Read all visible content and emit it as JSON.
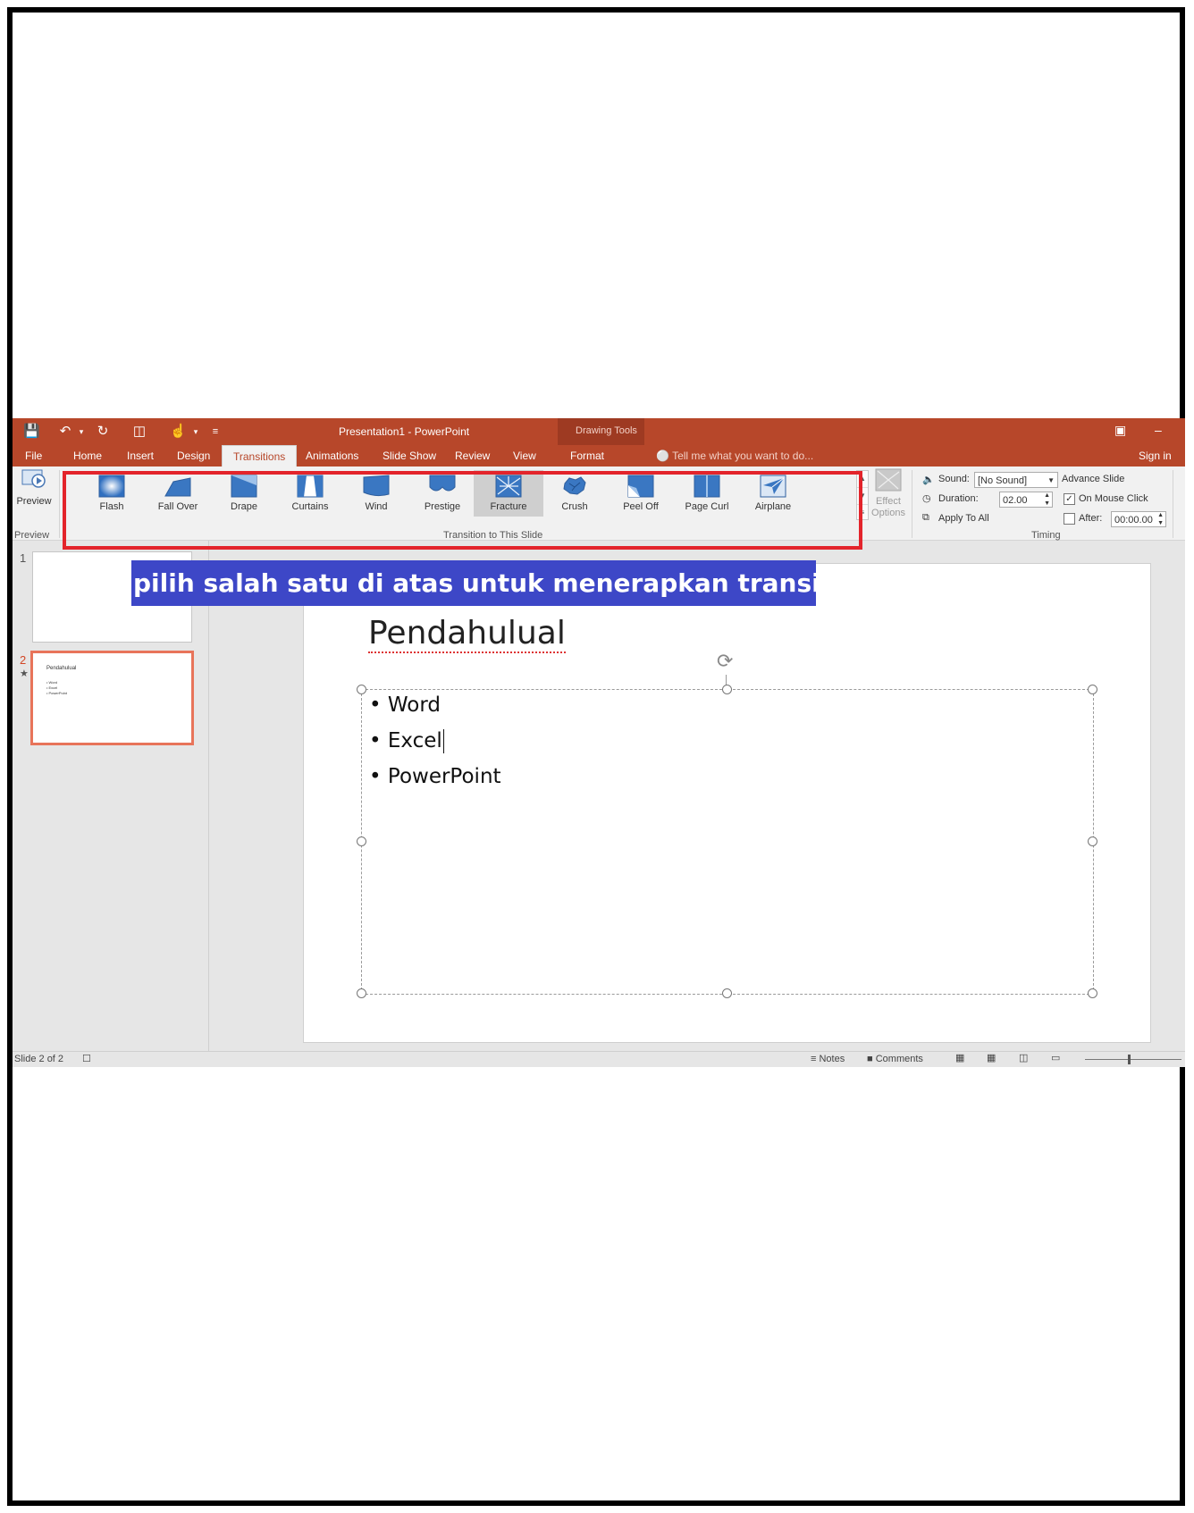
{
  "window": {
    "title": "Presentation1 - PowerPoint",
    "context_group": "Drawing Tools",
    "sign_in": "Sign in"
  },
  "tabs": [
    {
      "label": "File"
    },
    {
      "label": "Home"
    },
    {
      "label": "Insert"
    },
    {
      "label": "Design"
    },
    {
      "label": "Transitions",
      "active": true
    },
    {
      "label": "Animations"
    },
    {
      "label": "Slide Show"
    },
    {
      "label": "Review"
    },
    {
      "label": "View"
    },
    {
      "label": "Format"
    }
  ],
  "tell_me": "Tell me what you want to do...",
  "ribbon": {
    "preview": {
      "button_label": "Preview",
      "group_label": "Preview"
    },
    "transitions": {
      "group_label": "Transition to This Slide",
      "items": [
        {
          "label": "Flash",
          "icon": "flash-icon"
        },
        {
          "label": "Fall Over",
          "icon": "fall-over-icon"
        },
        {
          "label": "Drape",
          "icon": "drape-icon"
        },
        {
          "label": "Curtains",
          "icon": "curtains-icon"
        },
        {
          "label": "Wind",
          "icon": "wind-icon"
        },
        {
          "label": "Prestige",
          "icon": "prestige-icon"
        },
        {
          "label": "Fracture",
          "icon": "fracture-icon",
          "selected": true
        },
        {
          "label": "Crush",
          "icon": "crush-icon"
        },
        {
          "label": "Peel Off",
          "icon": "peel-off-icon"
        },
        {
          "label": "Page Curl",
          "icon": "page-curl-icon"
        },
        {
          "label": "Airplane",
          "icon": "airplane-icon"
        }
      ]
    },
    "effect_options": {
      "line1": "Effect",
      "line2": "Options"
    },
    "timing": {
      "group_label": "Timing",
      "sound_label": "Sound:",
      "sound_value": "[No Sound]",
      "duration_label": "Duration:",
      "duration_value": "02.00",
      "apply_all_label": "Apply To All",
      "advance_label": "Advance Slide",
      "on_mouse_click_label": "On Mouse Click",
      "on_mouse_click_checked": true,
      "after_label": "After:",
      "after_value": "00:00.00",
      "after_checked": false
    }
  },
  "thumbnails": [
    {
      "number": "1"
    },
    {
      "number": "2",
      "title": "Pendahulual",
      "bullets": [
        "Word",
        "Excel",
        "PowerPoint"
      ]
    }
  ],
  "slide": {
    "title": "Pendahulual",
    "bullets": [
      "Word",
      "Excel",
      "PowerPoint"
    ]
  },
  "status": {
    "slide_info": "Slide 2 of 2",
    "notes": "Notes",
    "comments": "Comments"
  },
  "annotation": "pilih salah satu di atas untuk menerapkan transisi",
  "colors": {
    "accent": "#b7472a",
    "highlight_box": "#e3242b",
    "banner": "#3d47c7"
  }
}
